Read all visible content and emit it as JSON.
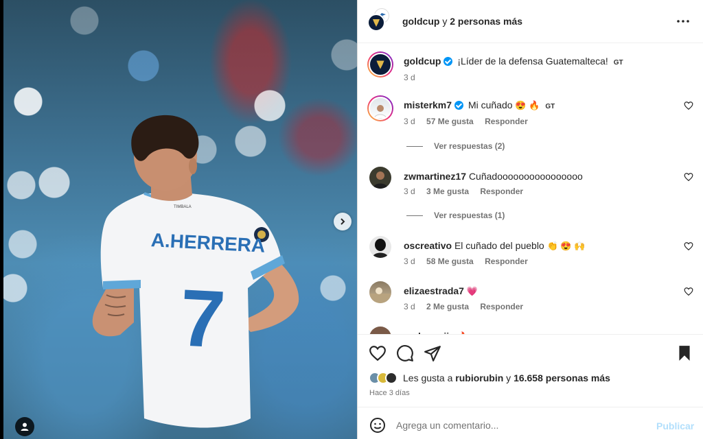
{
  "media": {
    "jersey_name": "A.HERRERA",
    "jersey_number": "7",
    "next_icon": "chevron-right-icon",
    "tag_icon": "user-tag-icon"
  },
  "header": {
    "username": "goldcup",
    "connector": " y ",
    "others": "2 personas más",
    "more_icon": "more-horizontal-icon"
  },
  "caption": {
    "username": "goldcup",
    "text": "¡Líder de la defensa Guatemalteca!",
    "flag": "GT",
    "time": "3 d"
  },
  "comments": [
    {
      "username": "misterkm7",
      "verified": true,
      "text": "Mi cuñado",
      "emoji": "😍 🔥",
      "flag": "GT",
      "time": "3 d",
      "likes": "57 Me gusta",
      "reply": "Responder",
      "replies": "Ver respuestas (2)"
    },
    {
      "username": "zwmartinez17",
      "verified": false,
      "text": "Cuñadoooooooooooooooo",
      "emoji": "",
      "flag": "",
      "time": "3 d",
      "likes": "3 Me gusta",
      "reply": "Responder",
      "replies": "Ver respuestas (1)"
    },
    {
      "username": "oscreativo",
      "verified": false,
      "text": "El cuñado del pueblo",
      "emoji": "👏 😍 🙌",
      "flag": "",
      "time": "3 d",
      "likes": "58 Me gusta",
      "reply": "Responder",
      "replies": ""
    },
    {
      "username": "elizaestrada7",
      "verified": false,
      "text": "",
      "emoji": "💗",
      "flag": "",
      "time": "3 d",
      "likes": "2 Me gusta",
      "reply": "Responder",
      "replies": ""
    },
    {
      "username": "arelymarija",
      "verified": false,
      "text": "",
      "emoji": "🔥",
      "flag": "",
      "time": "",
      "likes": "",
      "reply": "",
      "replies": ""
    }
  ],
  "actions": {
    "like_icon": "heart-icon",
    "comment_icon": "comment-icon",
    "share_icon": "send-icon",
    "save_icon": "bookmark-icon",
    "likes_prefix": "Les gusta a ",
    "likes_user": "rubiorubin",
    "likes_middle": " y ",
    "likes_count": "16.658 personas más",
    "posted_ago": "Hace 3 días"
  },
  "compose": {
    "placeholder": "Agrega un comentario...",
    "publish_label": "Publicar",
    "emoji_icon": "smiley-icon"
  },
  "colors": {
    "verified": "#0095f6",
    "publish_disabled": "#b2dffc",
    "muted_text": "#737373"
  }
}
